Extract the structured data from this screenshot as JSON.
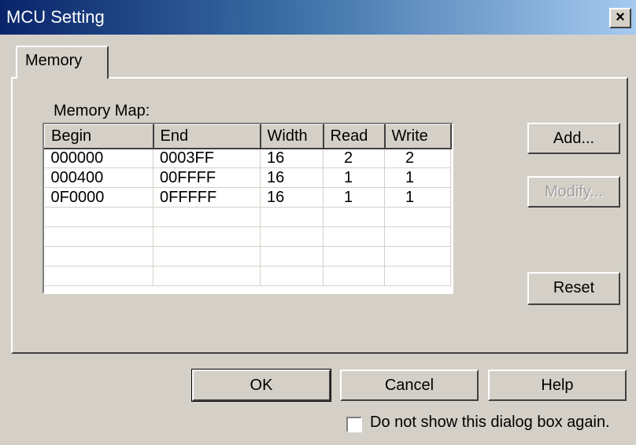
{
  "window": {
    "title": "MCU Setting",
    "close_label": "×"
  },
  "tabs": [
    {
      "label": "Memory"
    }
  ],
  "memory_map": {
    "label": "Memory Map:",
    "columns": [
      "Begin",
      "End",
      "Width",
      "Read",
      "Write"
    ],
    "rows": [
      [
        "000000",
        "0003FF",
        "16",
        "2",
        "2"
      ],
      [
        "000400",
        "00FFFF",
        "16",
        "1",
        "1"
      ],
      [
        "0F0000",
        "0FFFFF",
        "16",
        "1",
        "1"
      ],
      [
        "",
        "",
        "",
        "",
        ""
      ],
      [
        "",
        "",
        "",
        "",
        ""
      ],
      [
        "",
        "",
        "",
        "",
        ""
      ],
      [
        "",
        "",
        "",
        "",
        ""
      ]
    ]
  },
  "side_buttons": {
    "add": "Add...",
    "modify": "Modify...",
    "reset": "Reset"
  },
  "footer": {
    "ok": "OK",
    "cancel": "Cancel",
    "help": "Help",
    "checkbox_label": "Do not show this dialog box again.",
    "checkbox_checked": false
  },
  "colors": {
    "face": "#d4d0c8",
    "title_start": "#0a246a",
    "title_end": "#a6caf0",
    "disabled_text": "#a0a0a0"
  }
}
